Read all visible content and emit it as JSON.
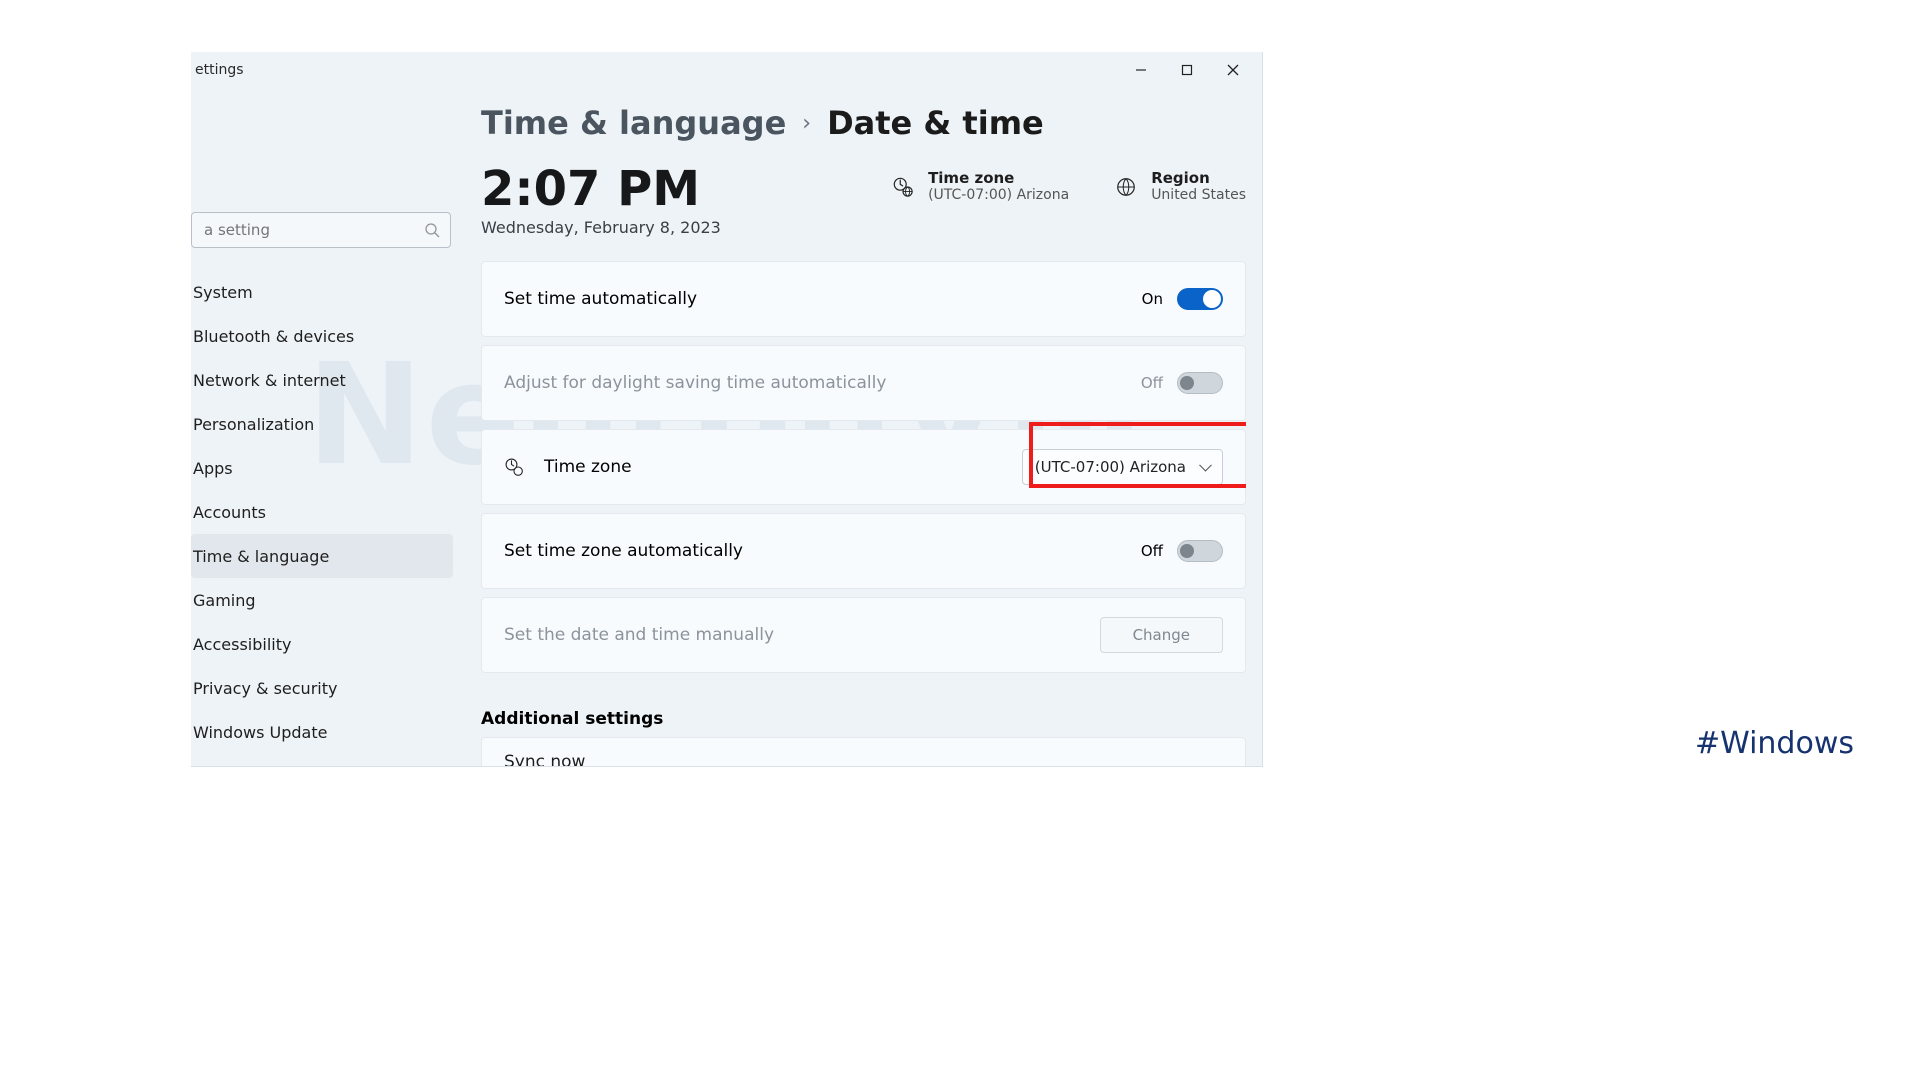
{
  "window": {
    "title": "ettings"
  },
  "search": {
    "placeholder": "a setting"
  },
  "sidebar": {
    "items": [
      "System",
      "Bluetooth & devices",
      "Network & internet",
      "Personalization",
      "Apps",
      "Accounts",
      "Time & language",
      "Gaming",
      "Accessibility",
      "Privacy & security",
      "Windows Update"
    ],
    "selected_index": 6
  },
  "breadcrumb": {
    "parent": "Time & language",
    "current": "Date & time"
  },
  "clock": {
    "time": "2:07 PM",
    "date": "Wednesday, February 8, 2023"
  },
  "summary": {
    "timezone": {
      "label": "Time zone",
      "value": "(UTC-07:00) Arizona"
    },
    "region": {
      "label": "Region",
      "value": "United States"
    }
  },
  "rows": {
    "auto_time": {
      "label": "Set time automatically",
      "state": "On"
    },
    "dst": {
      "label": "Adjust for daylight saving time automatically",
      "state": "Off"
    },
    "tz": {
      "label": "Time zone",
      "value": "(UTC-07:00) Arizona"
    },
    "auto_tz": {
      "label": "Set time zone automatically",
      "state": "Off"
    },
    "manual": {
      "label": "Set the date and time manually",
      "button": "Change"
    }
  },
  "additional": {
    "title": "Additional settings",
    "sync": "Sync now"
  },
  "watermark": "NeuronVM",
  "hashtag": "#Windows"
}
